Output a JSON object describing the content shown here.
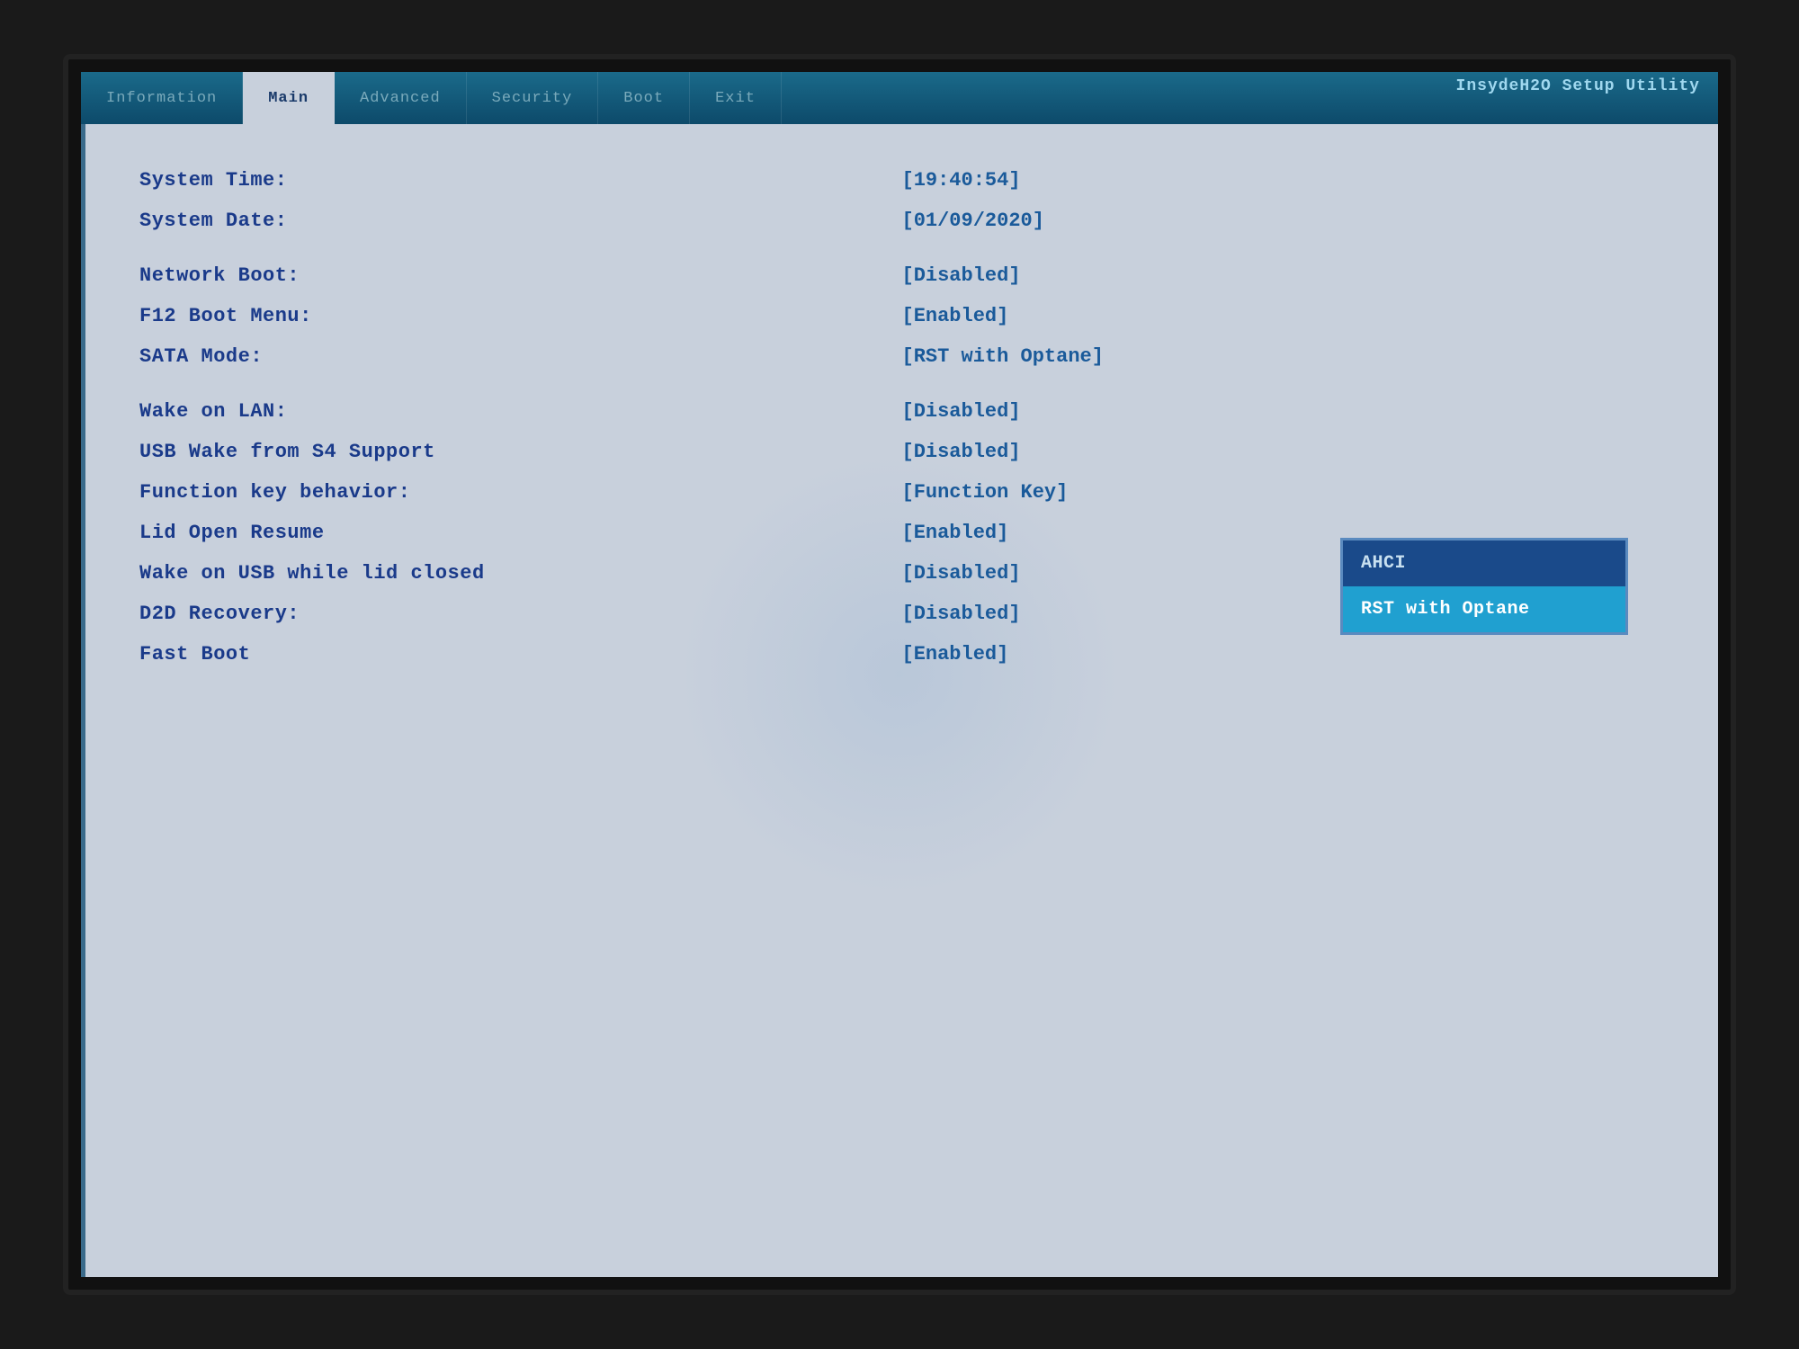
{
  "bios": {
    "title": "InsydeH2O Setup Utility",
    "nav": {
      "tabs": [
        {
          "id": "information",
          "label": "Information",
          "state": "inactive"
        },
        {
          "id": "main",
          "label": "Main",
          "state": "active"
        },
        {
          "id": "advanced",
          "label": "Advanced",
          "state": "inactive"
        },
        {
          "id": "security",
          "label": "Security",
          "state": "inactive"
        },
        {
          "id": "boot",
          "label": "Boot",
          "state": "inactive"
        },
        {
          "id": "exit",
          "label": "Exit",
          "state": "inactive"
        }
      ]
    },
    "settings": [
      {
        "label": "System Time:",
        "value": "[19:40:54]"
      },
      {
        "label": "System Date:",
        "value": "[01/09/2020]"
      },
      {
        "label": "",
        "value": ""
      },
      {
        "label": "Network Boot:",
        "value": "[Disabled]"
      },
      {
        "label": "F12 Boot Menu:",
        "value": "[Enabled]"
      },
      {
        "label": "SATA Mode:",
        "value": "[RST with Optane]"
      },
      {
        "label": "",
        "value": ""
      },
      {
        "label": "Wake on LAN:",
        "value": "[Disabled]"
      },
      {
        "label": "USB Wake from S4 Support",
        "value": "[Disabled]"
      },
      {
        "label": "Function key behavior:",
        "value": "[Function Key]"
      },
      {
        "label": "Lid Open Resume",
        "value": "[Enabled]"
      },
      {
        "label": "Wake on USB while lid closed",
        "value": "[Disabled]"
      },
      {
        "label": "D2D Recovery:",
        "value": "[Disabled]"
      },
      {
        "label": "Fast Boot",
        "value": "[Enabled]"
      }
    ],
    "dropdown": {
      "items": [
        {
          "label": "AHCI",
          "selected": false
        },
        {
          "label": "RST with Optane",
          "selected": true
        }
      ]
    }
  }
}
